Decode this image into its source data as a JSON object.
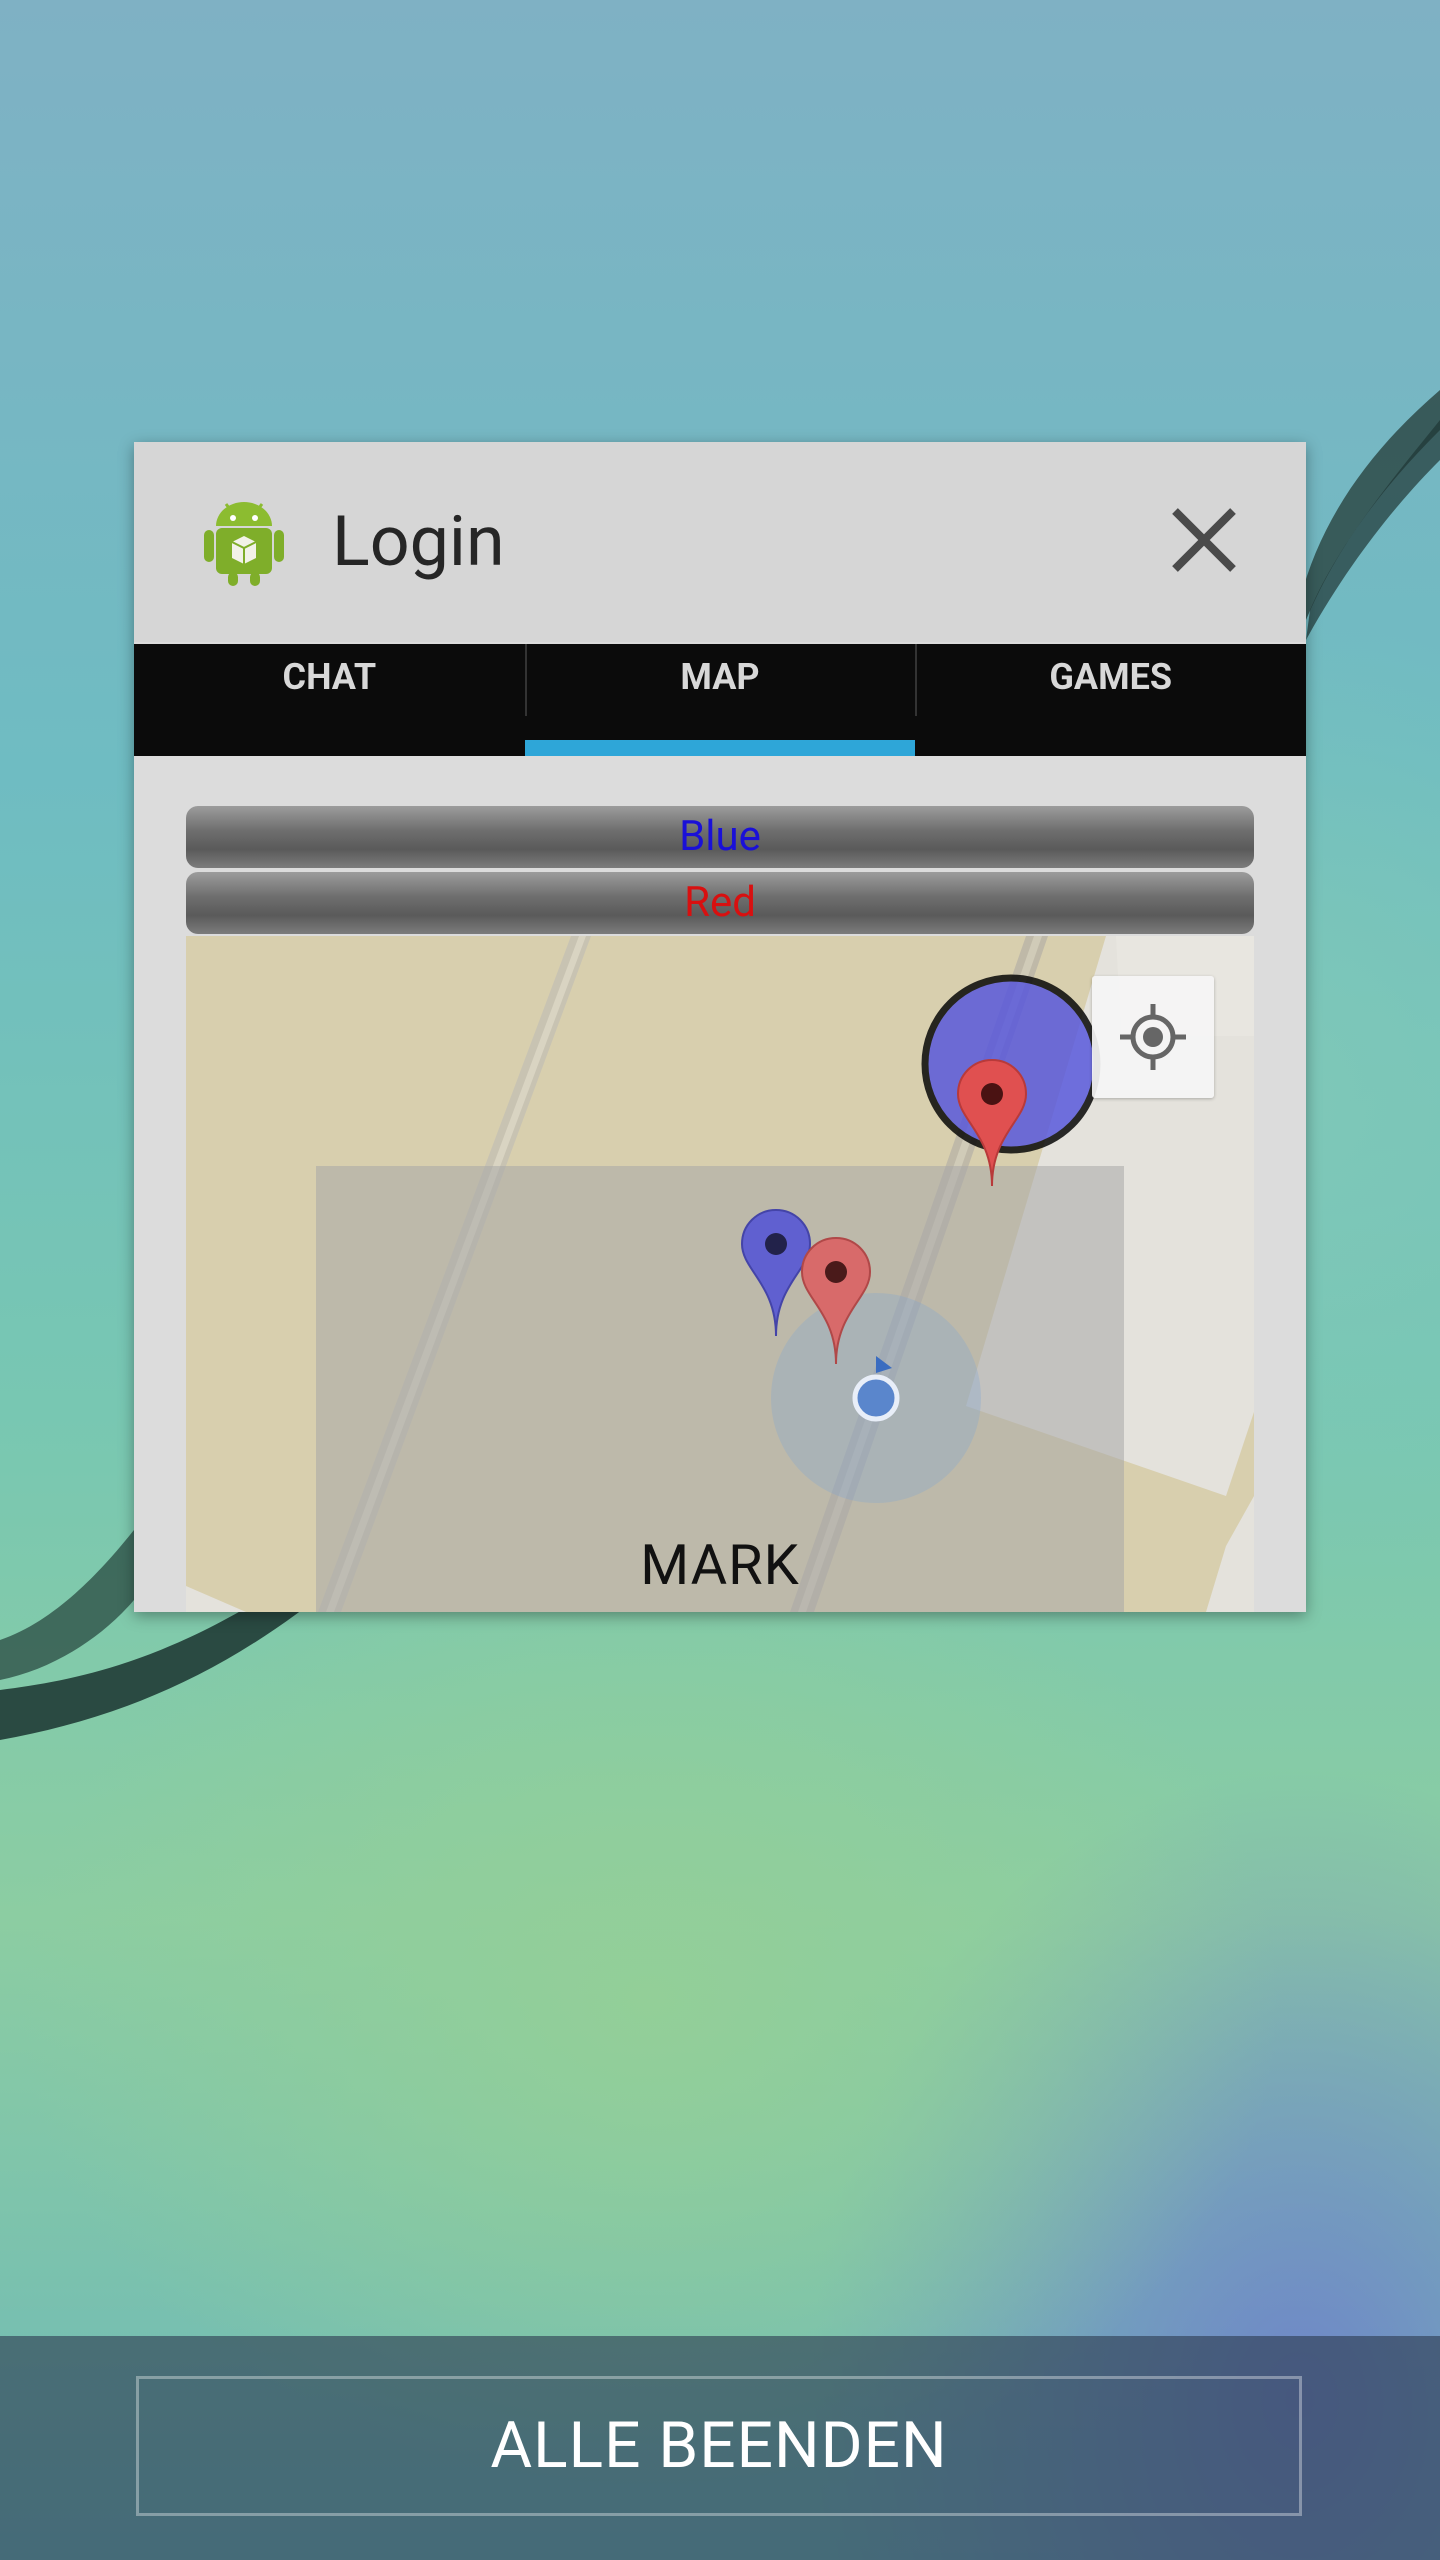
{
  "app_card": {
    "title": "Login",
    "icon": "android-icon",
    "close_icon": "close-icon"
  },
  "tabs": [
    {
      "label": "CHAT",
      "active": false
    },
    {
      "label": "MAP",
      "active": true
    },
    {
      "label": "GAMES",
      "active": false
    }
  ],
  "buttons": {
    "blue_label": "Blue",
    "red_label": "Red"
  },
  "map": {
    "label": "MARK",
    "locate_icon": "my-location-icon",
    "markers": [
      {
        "color": "red",
        "icon": "map-pin-icon"
      },
      {
        "color": "blue",
        "icon": "map-pin-icon"
      },
      {
        "color": "red",
        "icon": "map-pin-icon"
      }
    ]
  },
  "bottom": {
    "close_all_label": "ALLE BEENDEN"
  },
  "colors": {
    "tab_indicator": "#2ea6d8",
    "blue_text": "#1a10d8",
    "red_text": "#d81010",
    "marker_red": "#e05050",
    "marker_blue": "#6060d0"
  }
}
